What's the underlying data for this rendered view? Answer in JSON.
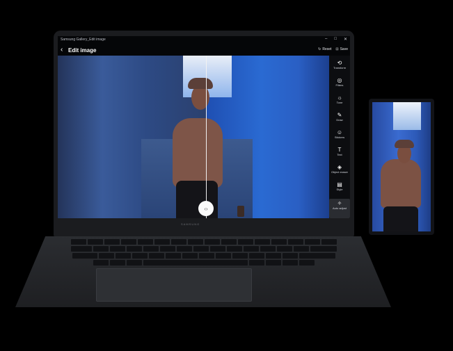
{
  "window": {
    "title": "Samsung Gallery_Edit image"
  },
  "header": {
    "back_icon": "back-arrow",
    "title": "Edit image",
    "reset_label": "Reset",
    "save_label": "Save"
  },
  "tools": [
    {
      "icon": "transform-icon",
      "label": "Transform"
    },
    {
      "icon": "filters-icon",
      "label": "Filters"
    },
    {
      "icon": "tone-icon",
      "label": "Tone"
    },
    {
      "icon": "draw-icon",
      "label": "Draw"
    },
    {
      "icon": "stickers-icon",
      "label": "Stickers"
    },
    {
      "icon": "text-icon",
      "label": "Text"
    },
    {
      "icon": "object-eraser-icon",
      "label": "Object eraser"
    },
    {
      "icon": "style-icon",
      "label": "Style"
    },
    {
      "icon": "auto-adjust-icon",
      "label": "Auto adjust",
      "active": true
    }
  ],
  "device": {
    "brand_label": "SAMSUNG"
  },
  "colors": {
    "background": "#000000",
    "screen_bg": "#050608",
    "split_line": "#f2f2f2",
    "accent_blue": "#2a6ad2"
  }
}
